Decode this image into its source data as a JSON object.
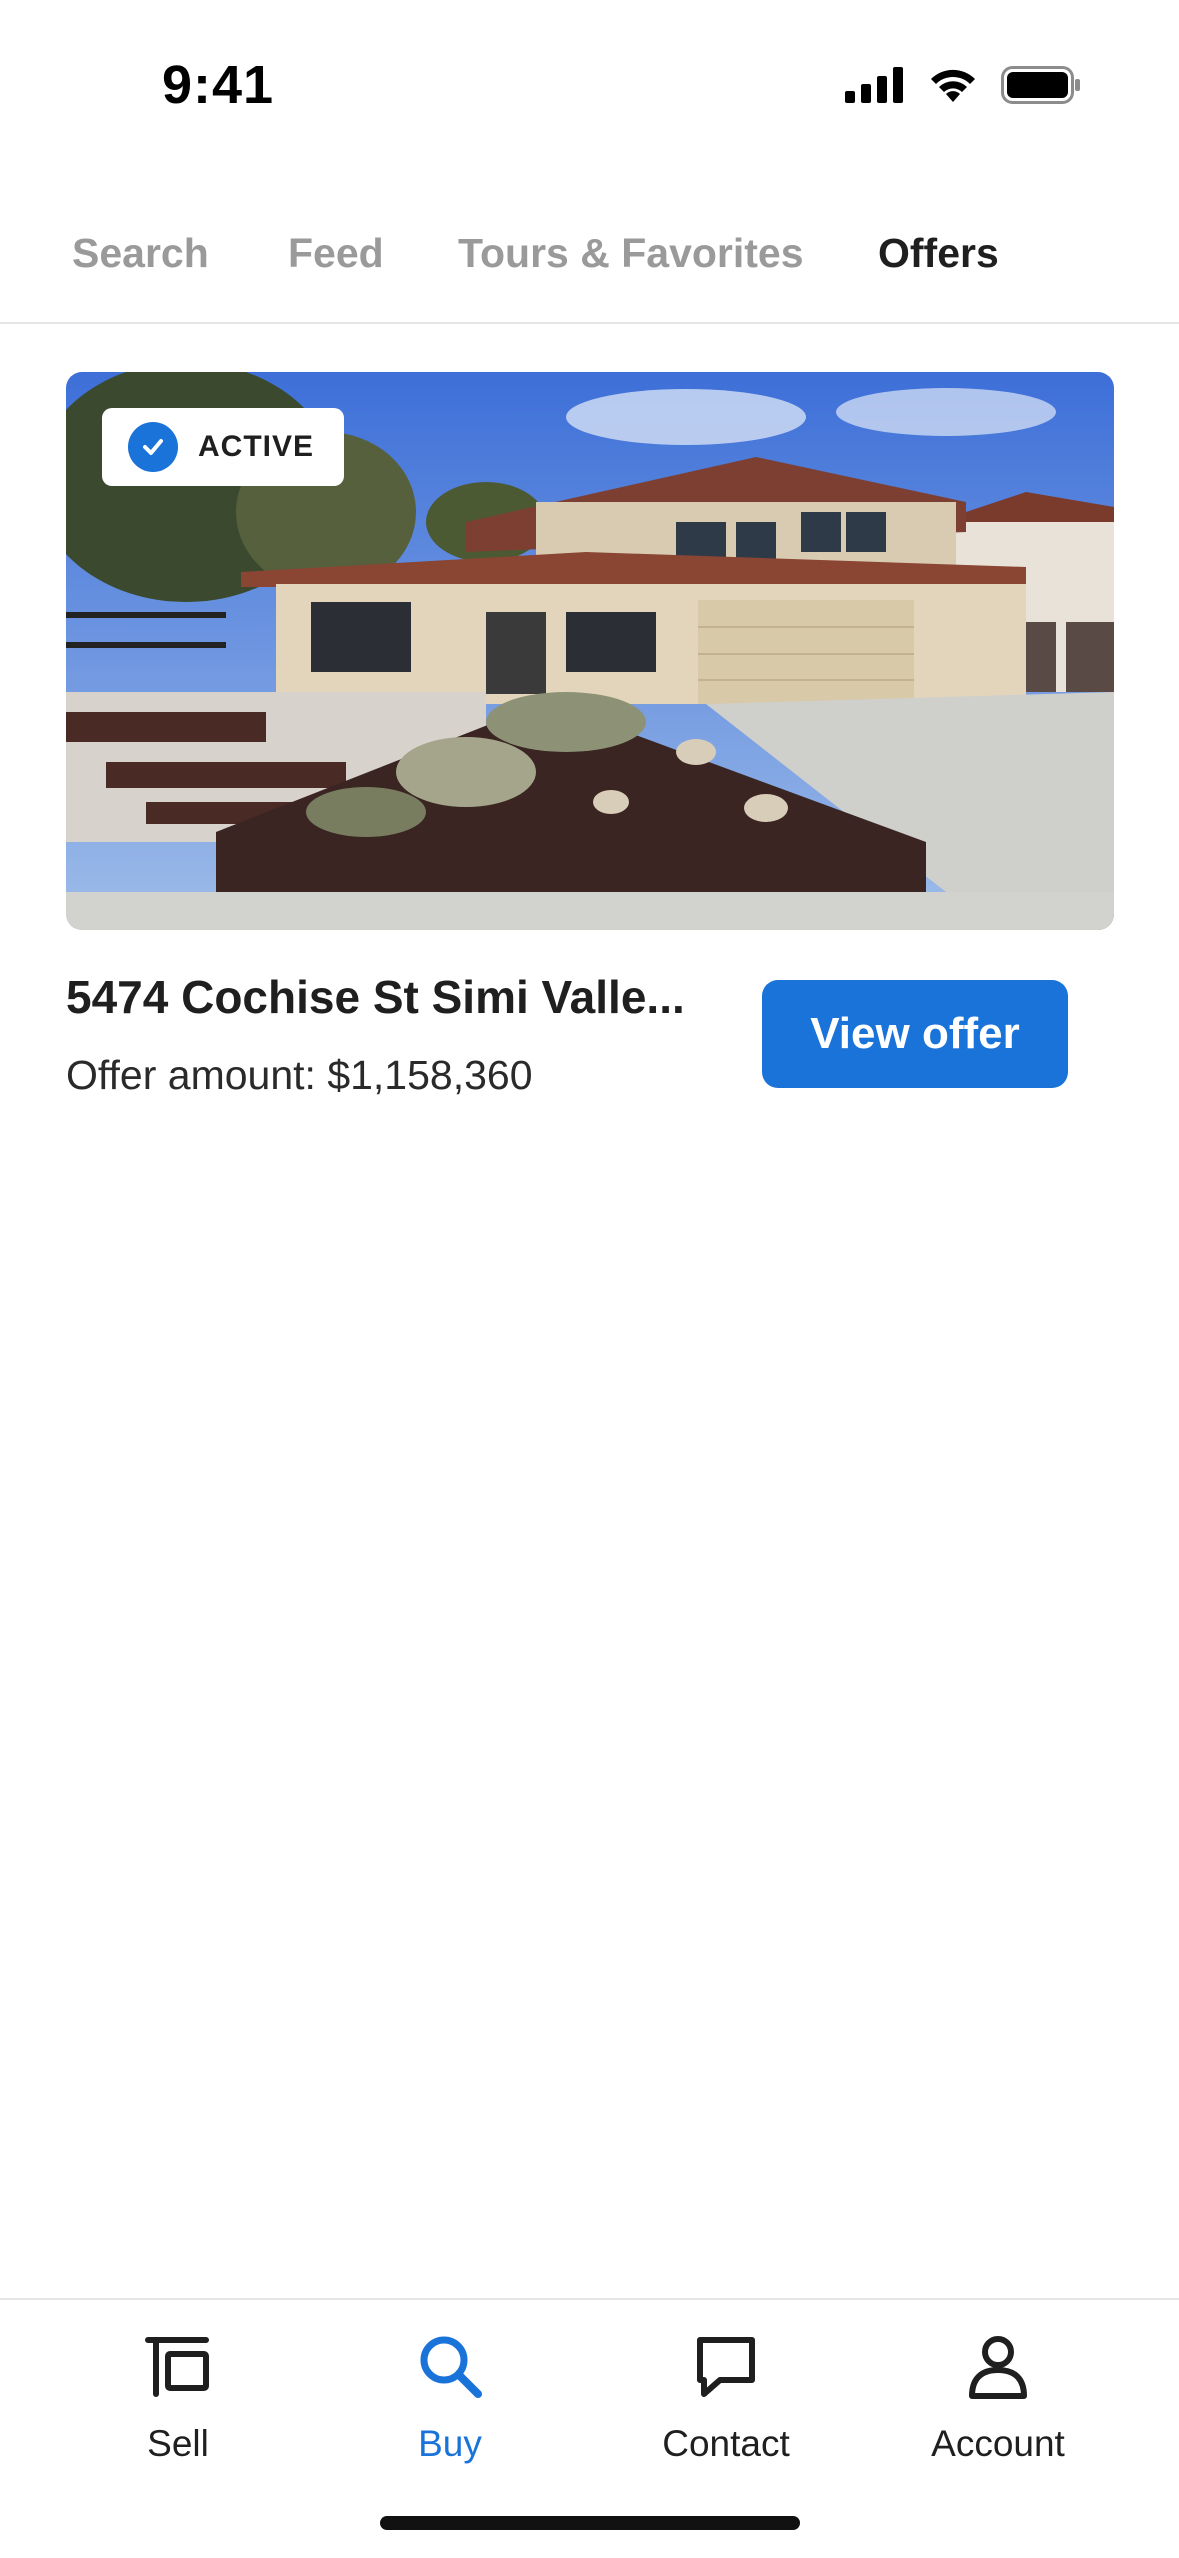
{
  "status_bar": {
    "time": "9:41"
  },
  "tabs": [
    {
      "label": "Search",
      "active": false
    },
    {
      "label": "Feed",
      "active": false
    },
    {
      "label": "Tours & Favorites",
      "active": false
    },
    {
      "label": "Offers",
      "active": true
    }
  ],
  "offer_card": {
    "status_badge": "ACTIVE",
    "address": "5474 Cochise St Simi Valle...",
    "offer_amount": "Offer amount: $1,158,360",
    "view_button": "View offer"
  },
  "bottom_nav": [
    {
      "label": "Sell",
      "icon": "sell-icon",
      "active": false
    },
    {
      "label": "Buy",
      "icon": "search-icon",
      "active": true
    },
    {
      "label": "Contact",
      "icon": "chat-icon",
      "active": false
    },
    {
      "label": "Account",
      "icon": "person-icon",
      "active": false
    }
  ],
  "colors": {
    "accent": "#1a73d9",
    "inactive_tab": "#9a9a9a",
    "text": "#1f1f1f"
  }
}
